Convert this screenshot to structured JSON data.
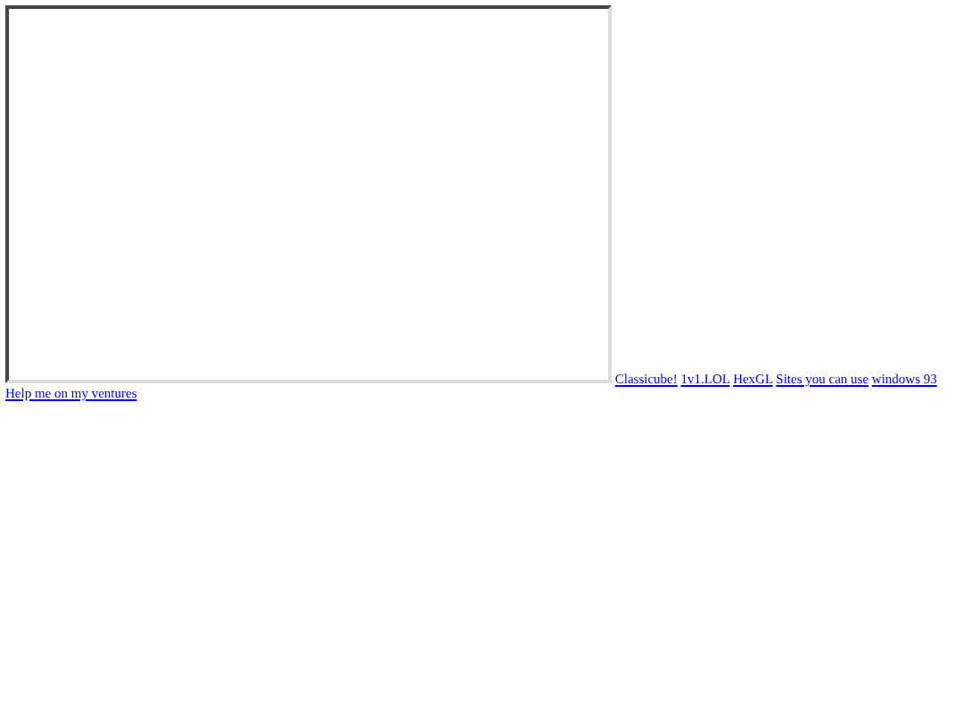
{
  "links": [
    "Classicube!",
    "1v1.LOL",
    "HexGL",
    "Sites you can use",
    "windows 93",
    "Help me on my ventures"
  ]
}
